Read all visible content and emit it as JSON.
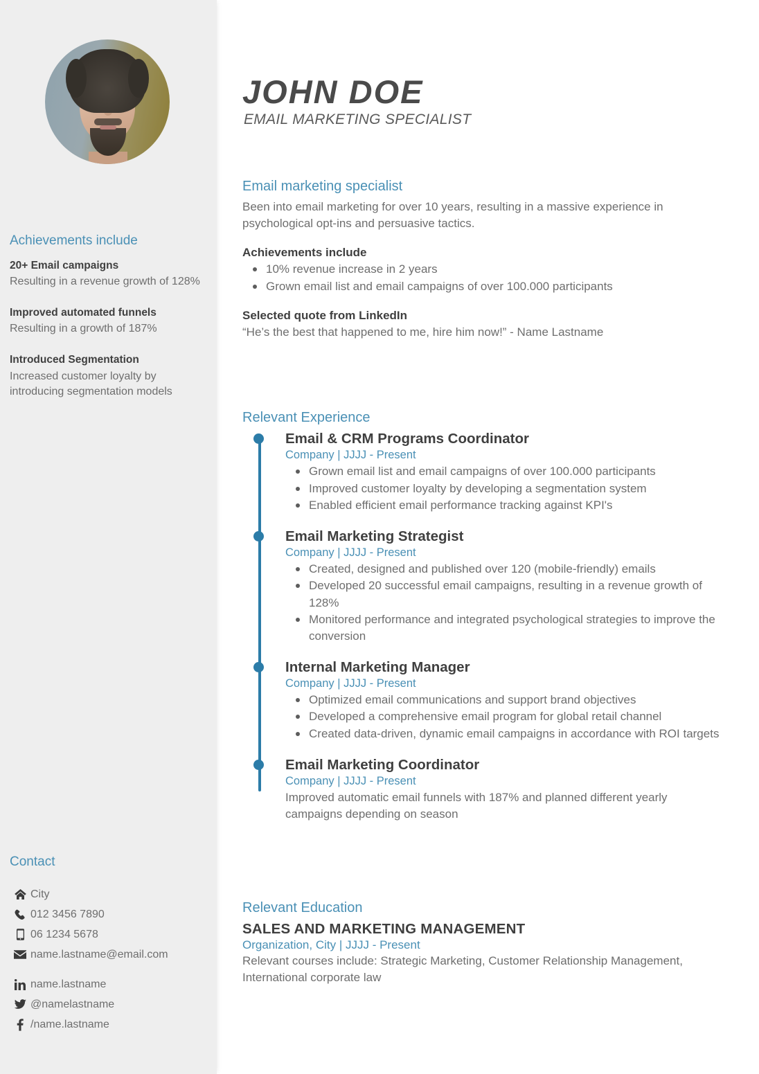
{
  "sidebar": {
    "photo": {
      "icon": "profile-photo",
      "alt": "Portrait photo of John Doe"
    },
    "achievements": {
      "heading": "Achievements include",
      "items": [
        {
          "title": "20+ Email campaigns",
          "text": "Resulting in a revenue growth of 128%"
        },
        {
          "title": "Improved automated funnels",
          "text": "Resulting in a growth of 187%"
        },
        {
          "title": "Introduced Segmentation",
          "text": "Increased customer loyalty by introducing segmentation models"
        }
      ]
    },
    "contact": {
      "heading": "Contact",
      "items": [
        {
          "icon": "home-icon",
          "value": "City"
        },
        {
          "icon": "phone-icon",
          "value": "012 3456 7890"
        },
        {
          "icon": "mobile-icon",
          "value": "06 1234 5678"
        },
        {
          "icon": "envelope-icon",
          "value": "name.lastname@email.com"
        }
      ],
      "social": [
        {
          "icon": "linkedin-icon",
          "value": "name.lastname"
        },
        {
          "icon": "twitter-icon",
          "value": "@namelastname"
        },
        {
          "icon": "facebook-icon",
          "value": "/name.lastname"
        }
      ]
    }
  },
  "header": {
    "name": "JOHN  DOE",
    "job_title": "EMAIL MARKETING SPECIALIST"
  },
  "summary": {
    "heading": "Email marketing specialist",
    "intro": "Been into email marketing for over 10 years, resulting in a massive experience in psychological opt-ins and persuasive tactics.",
    "achievements_label": "Achievements include",
    "achievements": [
      "10% revenue increase in 2 years",
      "Grown email list and email campaigns of over 100.000 participants"
    ],
    "quote_label": "Selected quote from LinkedIn",
    "quote": "“He’s the best that happened to me, hire him now!” - Name Lastname"
  },
  "experience": {
    "heading": "Relevant Experience",
    "items": [
      {
        "title": "Email & CRM Programs Coordinator",
        "meta": "Company | JJJJ - Present",
        "bullets": [
          "Grown email list and email campaigns of over 100.000 participants",
          "Improved customer loyalty by developing a segmentation system",
          "Enabled efficient email performance tracking against KPI's"
        ],
        "paragraph": ""
      },
      {
        "title": "Email Marketing Strategist",
        "meta": "Company | JJJJ - Present",
        "bullets": [
          "Created, designed and published over 120 (mobile-friendly) emails",
          "Developed 20 successful email campaigns, resulting in a revenue growth of 128%",
          "Monitored performance and integrated psychological strategies to improve the conversion"
        ],
        "paragraph": ""
      },
      {
        "title": "Internal Marketing Manager",
        "meta": "Company | JJJJ - Present",
        "bullets": [
          "Optimized email communications and support brand objectives",
          "Developed a comprehensive email program for global retail channel",
          "Created data-driven, dynamic email campaigns in accordance with ROI targets"
        ],
        "paragraph": ""
      },
      {
        "title": "Email Marketing Coordinator",
        "meta": "Company | JJJJ - Present",
        "bullets": [],
        "paragraph": "Improved automatic email funnels with 187% and planned different yearly campaigns depending on season"
      }
    ]
  },
  "education": {
    "heading": "Relevant Education",
    "title": "SALES AND MARKETING MANAGEMENT",
    "meta": "Organization, City | JJJJ - Present",
    "body": "Relevant courses include: Strategic Marketing, Customer Relationship Management, International corporate law"
  },
  "colors": {
    "accent_light": "#4a90b5",
    "accent_dark": "#2c7ca8",
    "sidebar_bg": "#eeeeee",
    "heading_text": "#3f3f3f",
    "body_text": "#6e6e6e"
  }
}
